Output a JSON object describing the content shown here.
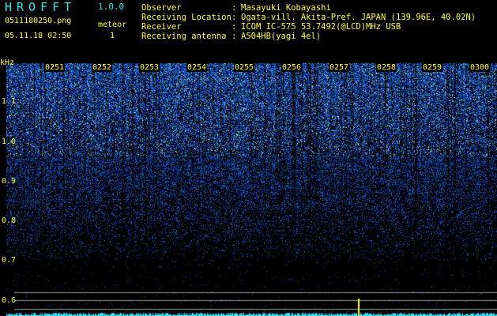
{
  "header": {
    "app_name": "HROFFT",
    "version": "1.0.0",
    "file_name": "0511180250.png",
    "meteor_label": "meteor",
    "meteor_count": "1",
    "datetime": "05.11.18 02:50"
  },
  "info": [
    {
      "key": "Observer",
      "value": "Masayuki Kobayashi"
    },
    {
      "key": "Receiving Location",
      "value": "Ogata-vill. Akita-Pref. JAPAN (139.96E, 40.02N)"
    },
    {
      "key": "Receiver",
      "value": "ICOM IC-575 53.7492(@LCD)MHz USB"
    },
    {
      "key": "Receiving antenna",
      "value": "A504HB(yagi 4el)"
    }
  ],
  "info_separator": ":",
  "spectrogram": {
    "y_unit": "kHz",
    "y_ticks": [
      "1.1",
      "1.0",
      "0.9",
      "0.8",
      "0.7",
      "0.6"
    ],
    "time_labels": [
      "0251",
      "0252",
      "0253",
      "0254",
      "0255",
      "0256",
      "0257",
      "0258",
      "0259",
      "0300"
    ],
    "colors": {
      "background": "#000000",
      "noise": "#2a4cff",
      "noise_dark": "#0a1a8c",
      "guide_lines": "#9a9a9a",
      "signal_trace": "#33e0ff",
      "meteor_echo": "#ffff33"
    }
  }
}
